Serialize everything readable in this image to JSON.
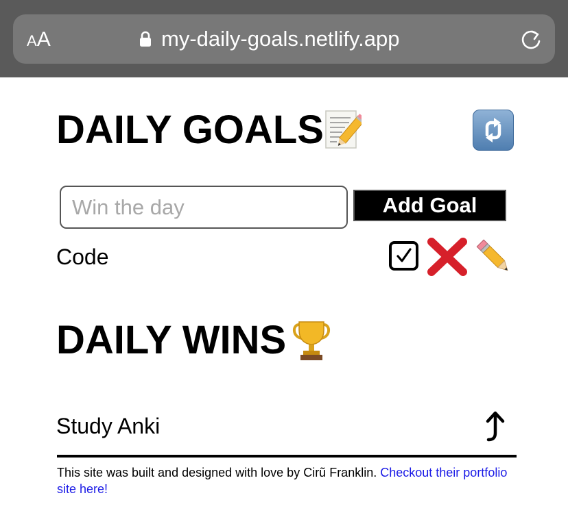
{
  "browser": {
    "aa_label_small": "A",
    "aa_label_large": "A",
    "url": "my-daily-goals.netlify.app",
    "icons": [
      "lock-icon",
      "reload-icon"
    ]
  },
  "goals": {
    "title": "DAILY GOALS",
    "title_emoji": "memo-icon",
    "refresh_icon": "refresh-arrows-icon",
    "input_placeholder": "Win the day",
    "input_value": "",
    "add_button_label": "Add Goal",
    "items": [
      {
        "text": "Code",
        "actions": [
          "check-icon",
          "cross-icon",
          "pencil-icon"
        ]
      }
    ]
  },
  "wins": {
    "title": "DAILY WINS",
    "title_emoji": "trophy-icon",
    "items": [
      {
        "text": "Study Anki",
        "action": "undo-arrow-icon"
      }
    ]
  },
  "footer": {
    "text": "This site was built and designed with love by Cirũ Franklin.",
    "link_text": "Checkout their portfolio site here!"
  },
  "colors": {
    "chrome_bg": "#5a5a5a",
    "urlbar_bg": "#787878",
    "link": "#1a1ae6",
    "button_bg": "#000000",
    "cross_red": "#d6202a",
    "refresh_blue": "#4f7eb0"
  }
}
